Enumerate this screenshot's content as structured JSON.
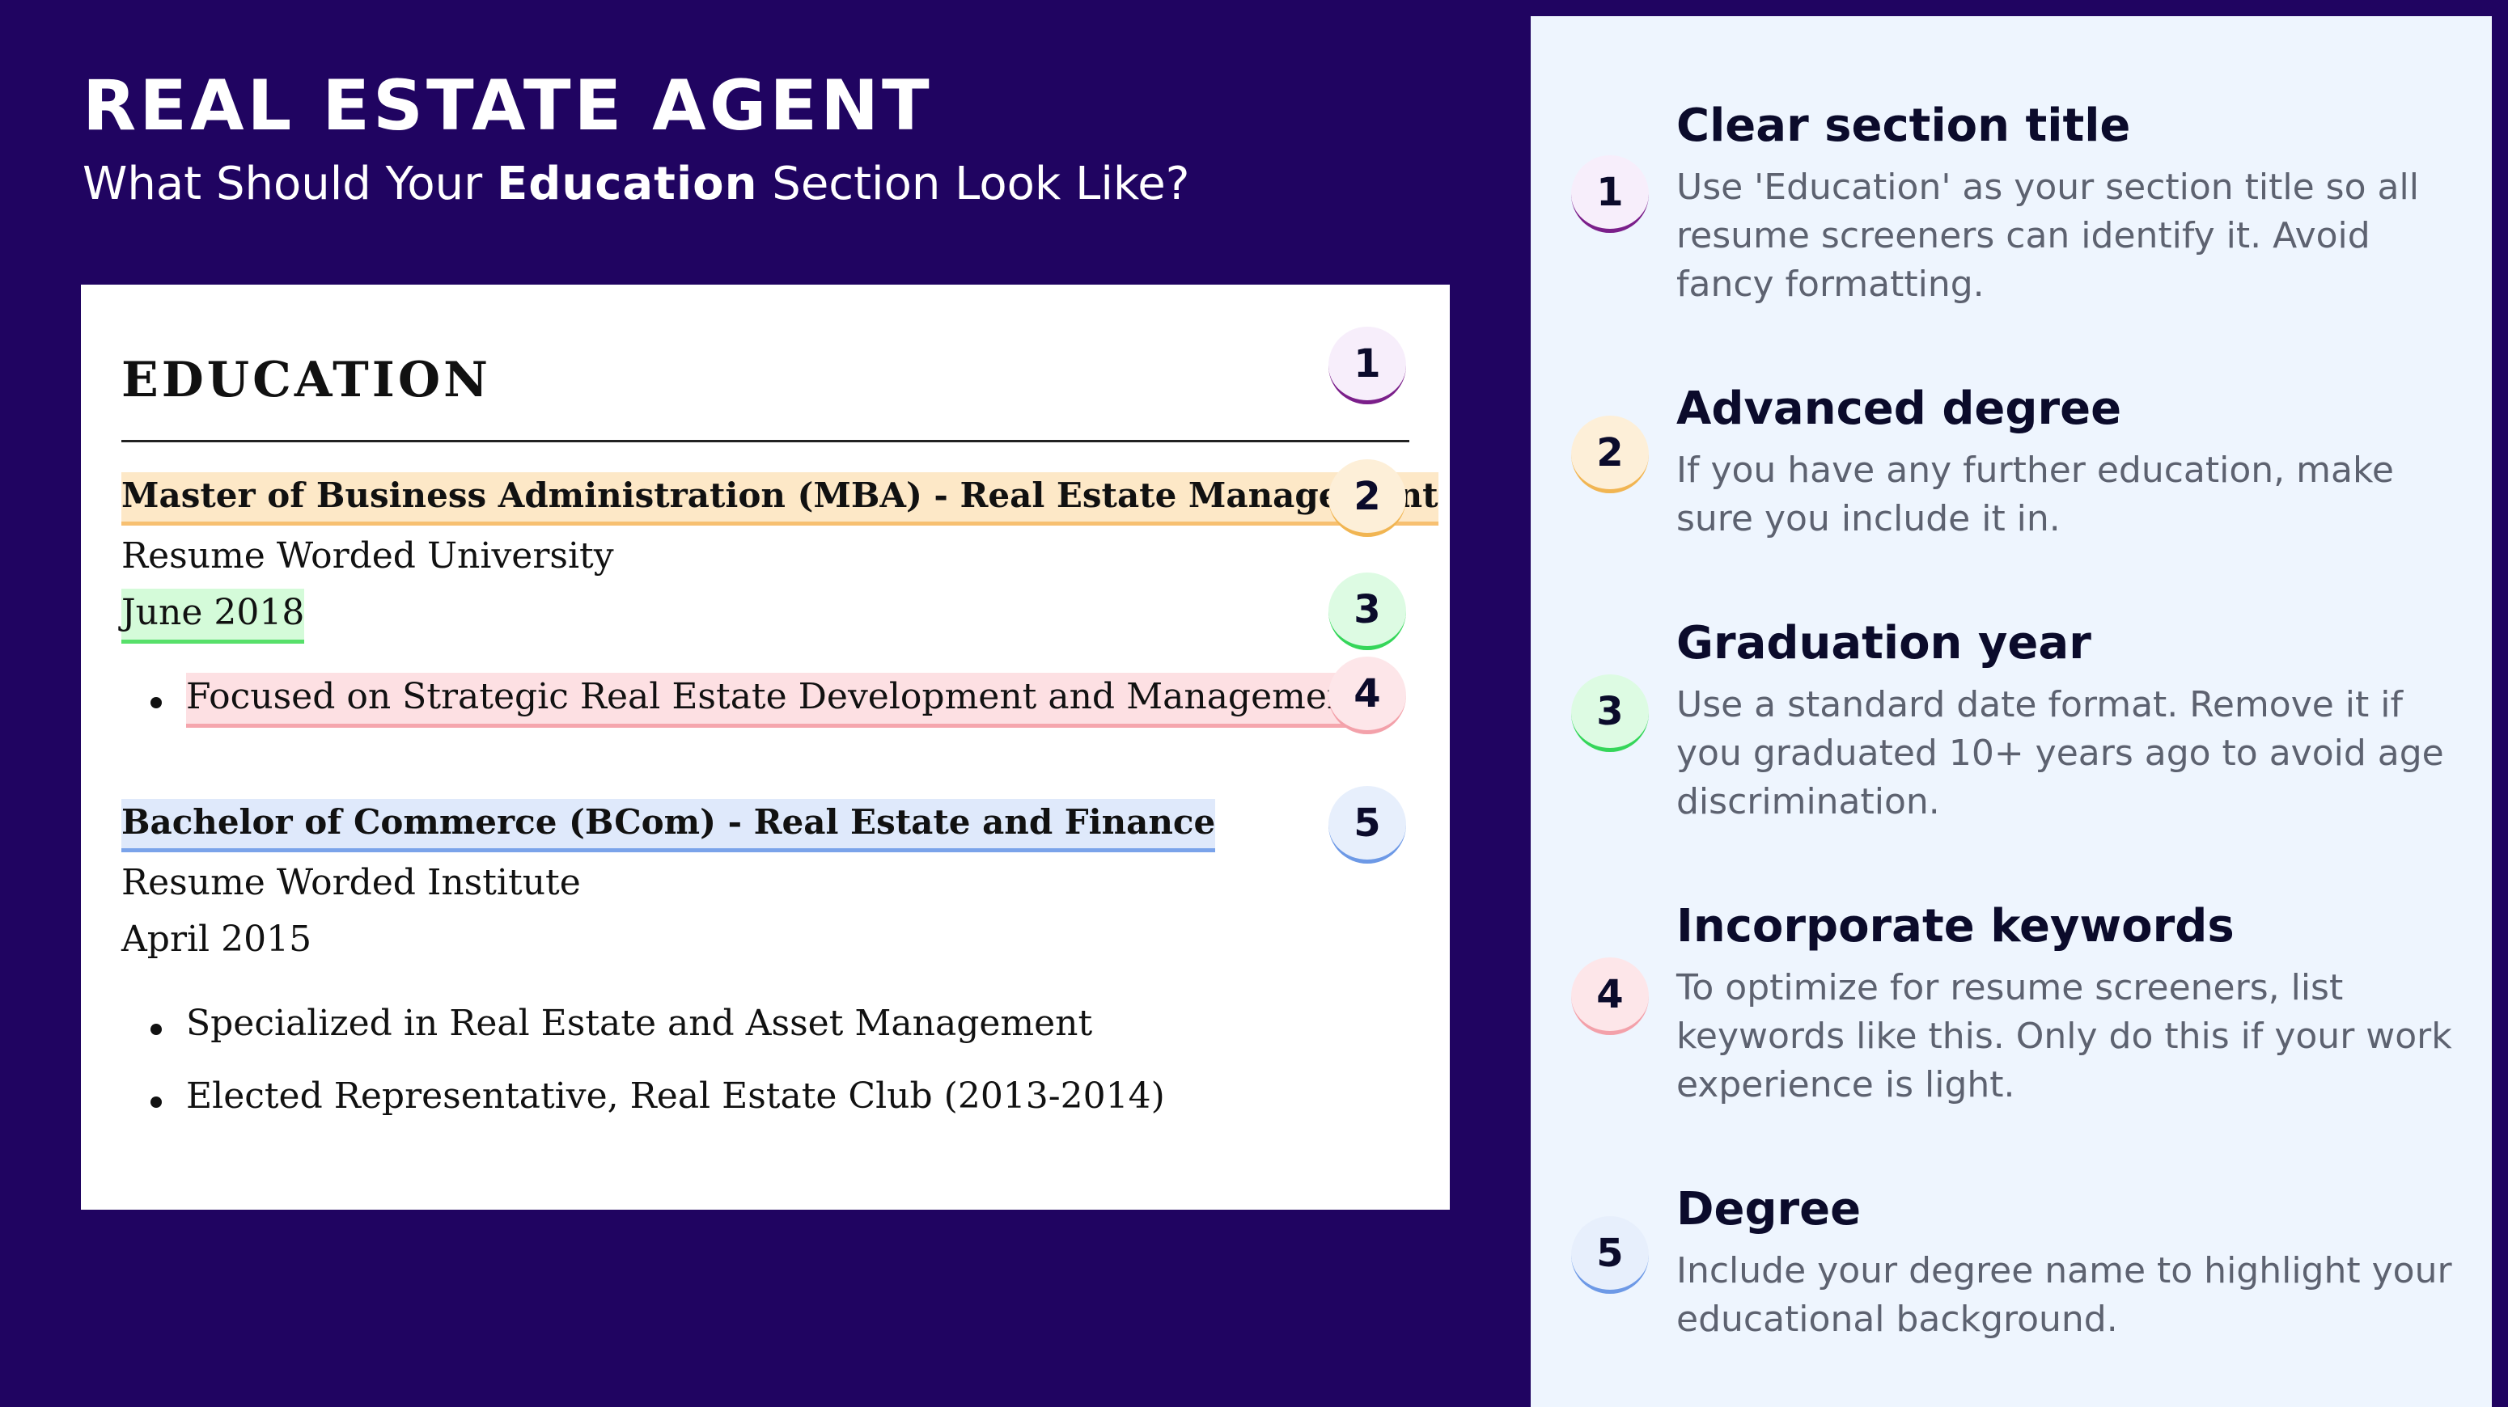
{
  "header": {
    "title": "REAL ESTATE AGENT",
    "subtitle_pre": "What Should Your ",
    "subtitle_bold": "Education",
    "subtitle_post": " Section Look Like?"
  },
  "resume": {
    "section_title": "EDUCATION",
    "entries": [
      {
        "degree": "Master of Business Administration (MBA) - Real Estate Management",
        "school": "Resume Worded University",
        "date": "June 2018",
        "bullets": [
          "Focused on Strategic Real Estate Development and Management"
        ]
      },
      {
        "degree": "Bachelor of Commerce (BCom) - Real Estate and Finance",
        "school": "Resume Worded Institute",
        "date": "April 2015",
        "bullets": [
          "Specialized in Real Estate and Asset Management",
          "Elected Representative, Real Estate Club (2013-2014)"
        ]
      }
    ],
    "markers": [
      "1",
      "2",
      "3",
      "4",
      "5"
    ]
  },
  "tips": [
    {
      "number": "1",
      "title": "Clear section title",
      "body": "Use 'Education' as your section title so all resume screeners can identify it. Avoid fancy formatting."
    },
    {
      "number": "2",
      "title": "Advanced degree",
      "body": "If you have any further education, make sure you include it in."
    },
    {
      "number": "3",
      "title": "Graduation year",
      "body": "Use a standard date format. Remove it if you graduated 10+ years ago to avoid age discrimination."
    },
    {
      "number": "4",
      "title": "Incorporate keywords",
      "body": "To optimize for resume screeners, list keywords like this. Only do this if your work experience is light."
    },
    {
      "number": "5",
      "title": "Degree",
      "body": "Include your degree name to highlight your educational background."
    }
  ],
  "colors": {
    "background": "#200461",
    "panel": "#eef5fe",
    "marker_1": "#7b1f8a",
    "marker_2": "#f1b552",
    "marker_3": "#35d65a",
    "marker_4": "#f3a1aa",
    "marker_5": "#6d99e6"
  }
}
